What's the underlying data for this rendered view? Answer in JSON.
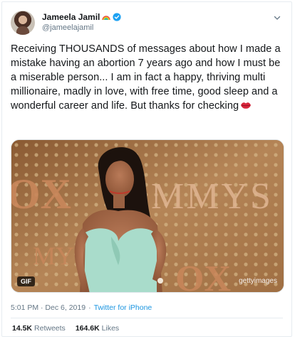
{
  "tweet": {
    "author": {
      "display_name": "Jameela Jamil",
      "handle": "@jameelajamil",
      "verified": true
    },
    "text": "Receiving THOUSANDS of messages about how I made a mistake having an abortion 7 years ago and how I must be a miserable person... I am in fact a happy, thriving multi millionaire, madly in love, with free time, good sleep and a wonderful career and life. But thanks for checking",
    "emoji_icon": "lips-icon",
    "media": {
      "badge": "GIF",
      "watermark": "gettyimages",
      "backdrop_text_left": "OX",
      "backdrop_text_right": "MMYS",
      "backdrop_text_bottom": "MY",
      "backdrop_text_bottom_right": "OX"
    },
    "timestamp": "5:01 PM · Dec 6, 2019",
    "separator": "·",
    "source": "Twitter for iPhone",
    "retweets": {
      "count": "14.5K",
      "label": "Retweets"
    },
    "likes": {
      "count": "164.6K",
      "label": "Likes"
    }
  },
  "colors": {
    "text": "#14171a",
    "secondary": "#657786",
    "link": "#1b95e0",
    "verified": "#1da1f2"
  }
}
